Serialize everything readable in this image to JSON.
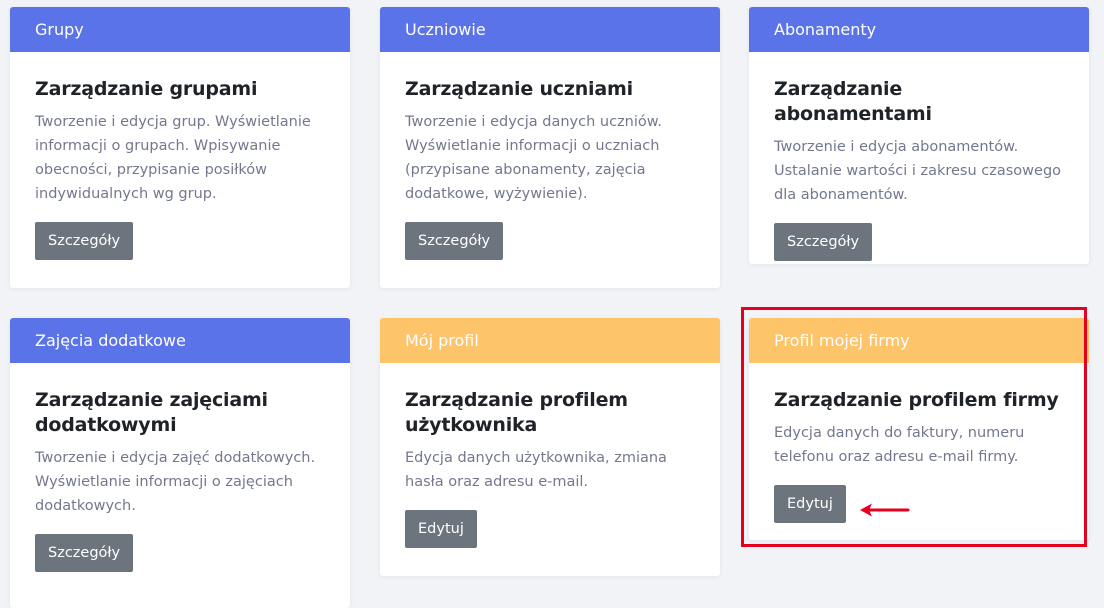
{
  "cards": [
    {
      "header": "Grupy",
      "title": "Zarządzanie grupami",
      "text": "Tworzenie i edycja grup. Wyświetlanie informacji o grupach. Wpisywanie obecności, przypisanie posiłków indywidualnych wg grup.",
      "button": "Szczegóły"
    },
    {
      "header": "Uczniowie",
      "title": "Zarządzanie uczniami",
      "text": "Tworzenie i edycja danych uczniów. Wyświetlanie informacji o uczniach (przypisane abonamenty, zajęcia dodatkowe, wyżywienie).",
      "button": "Szczegóły"
    },
    {
      "header": "Abonamenty",
      "title": "Zarządzanie abonamentami",
      "text": "Tworzenie i edycja abonamentów. Ustalanie wartości i zakresu czasowego dla abonamentów.",
      "button": "Szczegóły"
    },
    {
      "header": "Zajęcia dodatkowe",
      "title": "Zarządzanie zajęciami dodatkowymi",
      "text": "Tworzenie i edycja zajęć dodatkowych. Wyświetlanie informacji o zajęciach dodatkowych.",
      "button": "Szczegóły"
    },
    {
      "header": "Mój profil",
      "title": "Zarządzanie profilem użytkownika",
      "text": "Edycja danych użytkownika, zmiana hasła oraz adresu e-mail.",
      "button": "Edytuj"
    },
    {
      "header": "Profil mojej firmy",
      "title": "Zarządzanie profilem firmy",
      "text": "Edycja danych do faktury, numeru telefonu oraz adresu e-mail firmy.",
      "button": "Edytuj"
    }
  ],
  "colors": {
    "header_blue": "#5b73e8",
    "header_orange": "#fdc46a",
    "button_gray": "#6c757d",
    "highlight_red": "#e6001e"
  }
}
